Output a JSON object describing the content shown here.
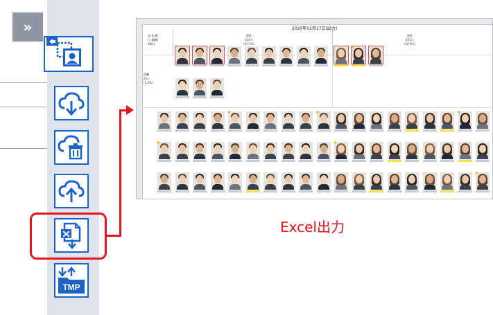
{
  "sidebar": {
    "expand_icon": "double-chevron-right-icon",
    "tools": [
      {
        "name": "select-photo-tool",
        "icon": "photo-select-icon"
      },
      {
        "name": "cloud-download-tool",
        "icon": "cloud-download-icon"
      },
      {
        "name": "cloud-delete-tool",
        "icon": "cloud-trash-icon"
      },
      {
        "name": "cloud-upload-tool",
        "icon": "cloud-upload-icon"
      },
      {
        "name": "excel-export-tool",
        "icon": "excel-export-icon"
      },
      {
        "name": "tmp-transfer-tool",
        "icon": "tmp-transfer-icon"
      }
    ],
    "tmp_label": "TMP"
  },
  "preview": {
    "title": "2020年02月17日(出力)",
    "left_header": [
      "全 社 数",
      "(一部略)",
      "468人"
    ],
    "male_header": [
      "男性",
      "314人",
      "(67.1%)"
    ],
    "female_header": [
      "女性",
      "201人",
      "(42.9%)"
    ],
    "row_label": [
      "役職",
      "65人",
      "(1.2%)"
    ]
  },
  "caption": "Excel出力",
  "colors": {
    "accent_blue": "#1b62c9",
    "highlight_red": "#e8141e",
    "strip": "#dfe3ea"
  }
}
